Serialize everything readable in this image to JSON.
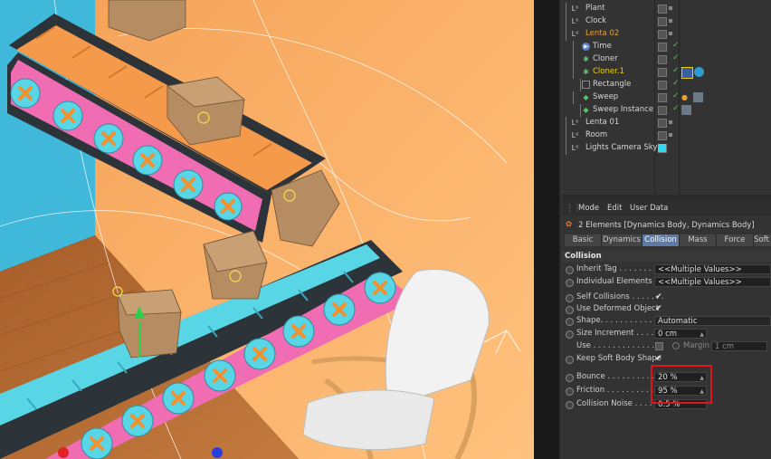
{
  "objects": [
    {
      "name": "Plant",
      "icon": "null-icon",
      "color": "#d6d6d6",
      "indent": 0
    },
    {
      "name": "Clock",
      "icon": "null-icon",
      "color": "#d6d6d6",
      "indent": 0
    },
    {
      "name": "Lenta 02",
      "icon": "null-icon",
      "color": "#e8a030",
      "indent": 0
    },
    {
      "name": "Time",
      "icon": "time-icon",
      "color": "#d6d6d6",
      "indent": 1
    },
    {
      "name": "Cloner",
      "icon": "cloner-icon",
      "color": "#d6d6d6",
      "indent": 1
    },
    {
      "name": "Cloner.1",
      "icon": "cloner-icon",
      "color": "#f0d000",
      "indent": 1
    },
    {
      "name": "Rectangle",
      "icon": "rectangle-icon",
      "color": "#d6d6d6",
      "indent": 2
    },
    {
      "name": "Sweep",
      "icon": "sweep-icon",
      "color": "#d6d6d6",
      "indent": 1
    },
    {
      "name": "Sweep Instance",
      "icon": "instance-icon",
      "color": "#d6d6d6",
      "indent": 2
    },
    {
      "name": "Lenta 01",
      "icon": "null-icon",
      "color": "#d6d6d6",
      "indent": 0
    },
    {
      "name": "Room",
      "icon": "null-icon",
      "color": "#d6d6d6",
      "indent": 0
    },
    {
      "name": "Lights Camera Sky",
      "icon": "null-icon",
      "color": "#d6d6d6",
      "indent": 0
    }
  ],
  "attr": {
    "menu": [
      "Mode",
      "Edit",
      "User Data"
    ],
    "elements_text": "2 Elements [Dynamics Body, Dynamics Body]",
    "tabs": [
      "Basic",
      "Dynamics",
      "Collision",
      "Mass",
      "Force",
      "Soft"
    ],
    "active_tab": "Collision",
    "section": "Collision",
    "rows": {
      "inherit_tag": {
        "label": "Inherit Tag . . . . . . . . . .",
        "value": "<<Multiple Values>>"
      },
      "individual_elements": {
        "label": "Individual Elements . .",
        "value": "<<Multiple Values>>"
      },
      "self_collisions": {
        "label": "Self Collisions . . . . . . .",
        "value": "✔"
      },
      "use_deformed": {
        "label": "Use Deformed Object",
        "value": "✔"
      },
      "shape": {
        "label": "Shape. . . . . . . . . . . . . . .",
        "value": "Automatic"
      },
      "size_increment": {
        "label": "Size Increment . . . . .",
        "value": "0 cm"
      },
      "use": {
        "label": "Use . . . . . . . . . . . . . .",
        "margin_label": "Margin",
        "margin_value": "1 cm"
      },
      "keep_soft": {
        "label": "Keep Soft Body Shape",
        "value": "✔"
      },
      "bounce": {
        "label": "Bounce . . . . . . . . . . . . .",
        "value": "20 %"
      },
      "friction": {
        "label": "Friction . . . . . . . . . . . . .",
        "value": "95 %"
      },
      "collision_noise": {
        "label": "Collision Noise . . . . . . .",
        "value": "0.5 %"
      }
    }
  },
  "colors": {
    "accent": "#5d7aa6",
    "highlight": "#e2141b",
    "wall": "#f7a860",
    "floor": "#b86d33",
    "belt_blue": "#55d7e6",
    "belt_pink": "#f26fb6",
    "roller": "#f59a4a",
    "box": "#b68c62"
  }
}
